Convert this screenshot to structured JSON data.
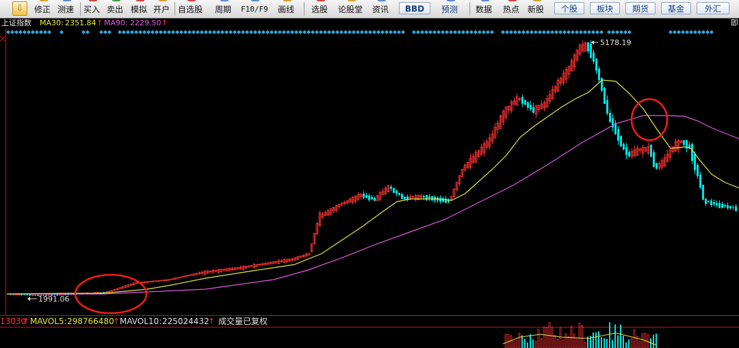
{
  "toolbar": {
    "items": [
      {
        "label": "修正",
        "name": "toolbar-fix-button"
      },
      {
        "label": "测速",
        "name": "toolbar-speedtest-button"
      },
      {
        "label": "买入",
        "name": "toolbar-buy-button"
      },
      {
        "label": "卖出",
        "name": "toolbar-sell-button"
      },
      {
        "label": "模拟",
        "name": "toolbar-simulate-button"
      },
      {
        "label": "开户",
        "name": "toolbar-open-account-button"
      },
      {
        "label": "自选股",
        "name": "toolbar-watchlist-button"
      },
      {
        "label": "周期",
        "name": "toolbar-period-button"
      },
      {
        "label": "F10/F9",
        "name": "toolbar-f10-button"
      },
      {
        "label": "画线",
        "name": "toolbar-draw-line-button"
      },
      {
        "label": "选股",
        "name": "toolbar-stock-picker-button"
      },
      {
        "label": "论股堂",
        "name": "toolbar-forum-button"
      },
      {
        "label": "资讯",
        "name": "toolbar-news-button"
      },
      {
        "label": "预测",
        "name": "toolbar-forecast-button"
      },
      {
        "label": "数据",
        "name": "toolbar-data-button"
      },
      {
        "label": "热点",
        "name": "toolbar-hotspot-button"
      },
      {
        "label": "新股",
        "name": "toolbar-ipo-button"
      }
    ],
    "pills": [
      {
        "label": "BBD",
        "name": "bbd-button"
      },
      {
        "label": "个股",
        "name": "tab-stock"
      },
      {
        "label": "板块",
        "name": "tab-sector"
      },
      {
        "label": "期货",
        "name": "tab-futures"
      },
      {
        "label": "基金",
        "name": "tab-fund"
      },
      {
        "label": "外汇",
        "name": "tab-forex"
      }
    ]
  },
  "indicator": {
    "name": "上证指数",
    "ma30_label": "MA30:",
    "ma30_value": "2351.84",
    "ma90_label": "MA90:",
    "ma90_value": "2229.50",
    "arrow": "↑",
    "edge_text": "即"
  },
  "annotations": {
    "high": "5178.19",
    "low": "1991.06"
  },
  "volume": {
    "cut_value": "13030",
    "mavol5_label": "MAVOL5:",
    "mavol5_value": "298766480",
    "mavol10_label": "MAVOL10:",
    "mavol10_value": "225024432",
    "note": "成交量已复权",
    "arrow": "↑"
  },
  "colors": {
    "up": "#ff3333",
    "down": "#00e4e4",
    "ma30": "#e8e83a",
    "ma90": "#e05ae0",
    "signal": "#36a6d8",
    "circle": "#ff1a1a",
    "frame": "#c01818"
  },
  "chart_data": {
    "type": "candlestick",
    "title": "上证指数",
    "series": [
      {
        "name": "MA30",
        "last_value": 2351.84
      },
      {
        "name": "MA90",
        "last_value": 2229.5
      }
    ],
    "marked_high": 5178.19,
    "marked_low": 1991.06,
    "volume_series": [
      {
        "name": "MAVOL5",
        "last_value": 298766480
      },
      {
        "name": "MAVOL10",
        "last_value": 225024432
      }
    ]
  }
}
